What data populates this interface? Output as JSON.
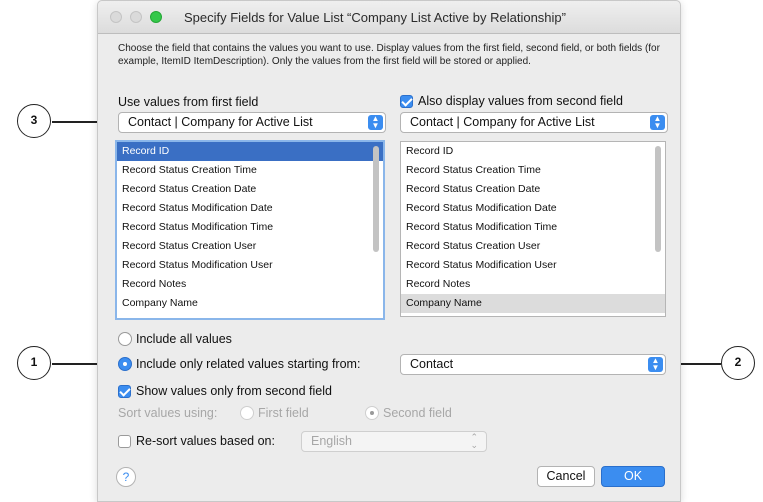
{
  "window": {
    "title": "Specify Fields for Value List “Company List Active by Relationship”"
  },
  "instructions": "Choose the field that contains the values you want to use.  Display values from the first field, second field, or both fields (for example, ItemID ItemDescription). Only the values from the first field will be stored or applied.",
  "first_field": {
    "label": "Use values from first field",
    "table_popup": "Contact | Company for Active List",
    "items": [
      "Record ID",
      "Record Status Creation Time",
      "Record Status Creation Date",
      "Record Status Modification Date",
      "Record Status Modification Time",
      "Record Status Creation User",
      "Record Status Modification User",
      "Record Notes",
      "Company Name"
    ],
    "selected": "Record ID"
  },
  "second_field": {
    "checkbox_label": "Also display values from second field",
    "checked": true,
    "table_popup": "Contact | Company for Active List",
    "items": [
      "Record ID",
      "Record Status Creation Time",
      "Record Status Creation Date",
      "Record Status Modification Date",
      "Record Status Modification Time",
      "Record Status Creation User",
      "Record Status Modification User",
      "Record Notes",
      "Company Name"
    ],
    "selected": "Company Name"
  },
  "options": {
    "include_all_label": "Include all values",
    "include_related_label": "Include only related values starting from:",
    "related_popup": "Contact",
    "show_second_only_label": "Show values only from second field",
    "show_second_only_checked": true,
    "sort_label": "Sort values using:",
    "sort_first": "First field",
    "sort_second": "Second field",
    "resort_label": "Re-sort values based on:",
    "resort_checked": false,
    "resort_language": "English"
  },
  "buttons": {
    "help": "?",
    "cancel": "Cancel",
    "ok": "OK"
  },
  "callouts": {
    "one": "1",
    "two": "2",
    "three": "3"
  },
  "colors": {
    "accent": "#3b8df0",
    "selection": "#3a6fc4",
    "window_bg": "#ececec"
  },
  "icons": {
    "popup_arrows": "▲▼",
    "disabled_popup_arrows": "⌃⌄"
  }
}
